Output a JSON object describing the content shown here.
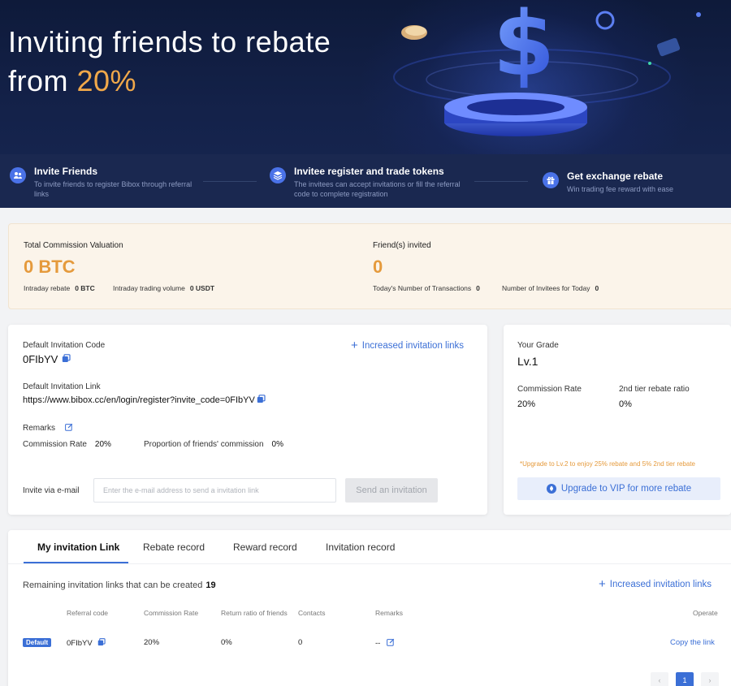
{
  "hero": {
    "title_line1": "Inviting friends to rebate",
    "title_line2_prefix": "from ",
    "title_line2_accent": "20%",
    "steps": [
      {
        "title": "Invite Friends",
        "desc": "To invite friends to register Bibox through referral links"
      },
      {
        "title": "Invitee register and trade tokens",
        "desc": "The invitees can accept invitations or fill the referral code to complete registration"
      },
      {
        "title": "Get exchange rebate",
        "desc": "Win trading fee reward with ease"
      }
    ]
  },
  "stats": {
    "commission_label": "Total Commission Valuation",
    "commission_value": "0 BTC",
    "intraday_rebate_label": "Intraday rebate",
    "intraday_rebate_value": "0 BTC",
    "intraday_volume_label": "Intraday trading volume",
    "intraday_volume_value": "0 USDT",
    "friends_label": "Friend(s) invited",
    "friends_value": "0",
    "transactions_label": "Today's Number of Transactions",
    "transactions_value": "0",
    "invitees_label": "Number of Invitees for Today",
    "invitees_value": "0"
  },
  "invitation": {
    "code_label": "Default Invitation Code",
    "code_value": "0FIbYV",
    "increase_label": "Increased invitation links",
    "link_label": "Default Invitation Link",
    "link_value": "https://www.bibox.cc/en/login/register?invite_code=0FIbYV",
    "remarks_label": "Remarks",
    "commission_rate_label": "Commission Rate",
    "commission_rate_value": "20%",
    "proportion_label": "Proportion of friends' commission",
    "proportion_value": "0%",
    "email_label": "Invite via e-mail",
    "email_placeholder": "Enter the e-mail address to send a invitation link",
    "send_label": "Send an invitation"
  },
  "grade": {
    "label": "Your Grade",
    "value": "Lv.1",
    "commission_label": "Commission Rate",
    "commission_value": "20%",
    "tier2_label": "2nd tier rebate ratio",
    "tier2_value": "0%",
    "upgrade_note": "*Upgrade to Lv.2 to enjoy 25% rebate and 5% 2nd tier rebate",
    "upgrade_button": "Upgrade to VIP for more rebate"
  },
  "records": {
    "tabs": [
      "My invitation Link",
      "Rebate record",
      "Reward record",
      "Invitation record"
    ],
    "remaining_label": "Remaining invitation links that can be created",
    "remaining_value": "19",
    "increase_label": "Increased invitation links",
    "columns": [
      "Referral code",
      "Commission Rate",
      "Return ratio of friends",
      "Contacts",
      "Remarks",
      "Operate"
    ],
    "row": {
      "badge": "Default",
      "code": "0FIbYV",
      "commission": "20%",
      "return_ratio": "0%",
      "contacts": "0",
      "remarks": "--",
      "operate": "Copy the link"
    },
    "pager": {
      "prev": "‹",
      "page": "1",
      "next": "›"
    }
  },
  "colors": {
    "accent": "#e59a3c",
    "brand": "#3b6fd6",
    "hero_bg": "#0e1a3a"
  }
}
